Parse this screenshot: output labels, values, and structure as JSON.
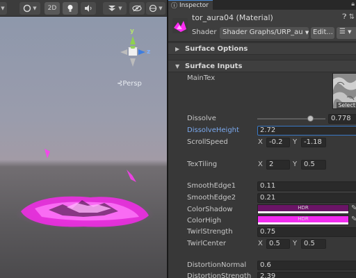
{
  "scene": {
    "toolbar": {
      "mode_2d_label": "2D",
      "icons": [
        "shading-mode-icon",
        "lightbulb-icon",
        "audio-icon",
        "effects-icon",
        "hidden-objects-icon"
      ]
    },
    "gizmo": {
      "y_label": "y",
      "z_label": "z"
    },
    "persp_label": "Persp"
  },
  "inspector": {
    "tab_label": "Inspector",
    "material_title": "tor_aura04 (Material)",
    "shader_label": "Shader",
    "shader_value": "Shader Graphs/URP_au",
    "edit_label": "Edit...",
    "surface_options_label": "Surface Options",
    "surface_inputs_label": "Surface Inputs",
    "properties": {
      "main_tex": {
        "label": "MainTex",
        "select_label": "Select"
      },
      "dissolve": {
        "label": "Dissolve",
        "value": "0.778",
        "fraction": 0.778
      },
      "dissolve_height": {
        "label": "DissolveHeight",
        "value": "2.72"
      },
      "scroll_speed": {
        "label": "ScrollSpeed",
        "x_axis": "X",
        "x": "-0.2",
        "y_axis": "Y",
        "y": "-1.18"
      },
      "tex_tiling": {
        "label": "TexTiling",
        "x_axis": "X",
        "x": "2",
        "y_axis": "Y",
        "y": "0.5"
      },
      "smooth_edge1": {
        "label": "SmoothEdge1",
        "value": "0.11"
      },
      "smooth_edge2": {
        "label": "SmoothEdge2",
        "value": "0.21"
      },
      "color_shadow": {
        "label": "ColorShadow",
        "hdr": "HDR",
        "color": "#6a1466"
      },
      "color_high": {
        "label": "ColorHigh",
        "hdr": "HDR",
        "color": "#f22cf0"
      },
      "twirl_strength": {
        "label": "TwirlStrength",
        "value": "0.75"
      },
      "twirl_center": {
        "label": "TwirlCenter",
        "x_axis": "X",
        "x": "0.5",
        "y_axis": "Y",
        "y": "0.5"
      },
      "distortion_normal": {
        "label": "DistortionNormal",
        "value": "0.6"
      },
      "distortion_strength": {
        "label": "DistortionStrength",
        "value": "2.39"
      }
    }
  },
  "colors": {
    "accent_magenta": "#ff2cf5",
    "focus_blue": "#3a79c6",
    "panel_bg": "#383838"
  }
}
